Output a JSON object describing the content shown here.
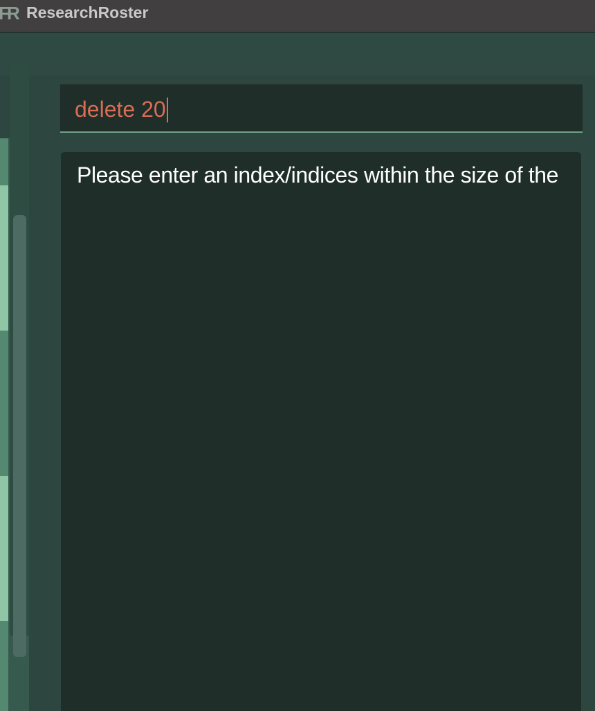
{
  "window": {
    "title": "ResearchRoster",
    "logo_icon": "researchroster-logo-icon"
  },
  "command": {
    "value": "delete 20"
  },
  "result": {
    "message": "Please enter an index/indices within the size of the"
  },
  "colors": {
    "title_bar": "#413f40",
    "menu_bar": "#2f4a42",
    "background": "#2d463f",
    "command_text": "#d96d56",
    "panel": "#1f2e28",
    "accent_green": "#8fc6a5",
    "result_text": "#ffffff"
  }
}
